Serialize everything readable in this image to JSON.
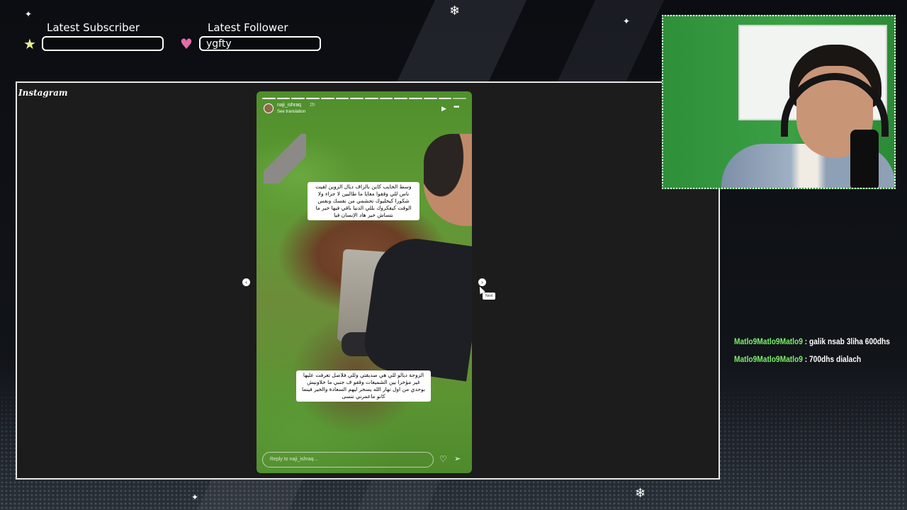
{
  "overlay": {
    "latest_subscriber_label": "Latest Subscriber",
    "latest_subscriber_value": "",
    "latest_follower_label": "Latest Follower",
    "latest_follower_value": "ygfty",
    "subscriber_icon": "star-icon",
    "follower_icon": "heart-icon",
    "accent_color": "#7cf06a"
  },
  "instagram": {
    "logo_text": "Instagram",
    "story": {
      "username": "naji_ishraq",
      "time": "2h",
      "see_translation": "See translation",
      "caption_top": "وسط الخايب كاين بالزاف ديال الزوين لقيت ناس للي وقفوا معايا ما طالبين لا جزاء ولا شكورا كيخليوك تحشمي من نفسك ونفس الوقت كيفكروك بللي الدنيا باقي فيها خير ما نتساش خير هاد الإنسان فيا",
      "caption_bottom": "الزوجة ديالو للي هي صديقتي وللي فلاصل تعرفت عليها غير مؤخرا بين الشميعات وقفو ف جنبي ما خلاونيش بوحدي من اول نهار الله يسخر ليهم السعادة والخير فينما كانو ماعمرني ننسى",
      "reply_placeholder": "Reply to naji_ishraq...",
      "progress_total": 14,
      "progress_done": 13
    },
    "next_tooltip": "Next"
  },
  "chat": {
    "messages": [
      {
        "user": "Matlo9Matlo9Matlo9",
        "text": " : galik nsab 3liha 600dhs"
      },
      {
        "user": "Matlo9Matlo9Matlo9",
        "text": " : 700dhs dialach"
      }
    ]
  }
}
